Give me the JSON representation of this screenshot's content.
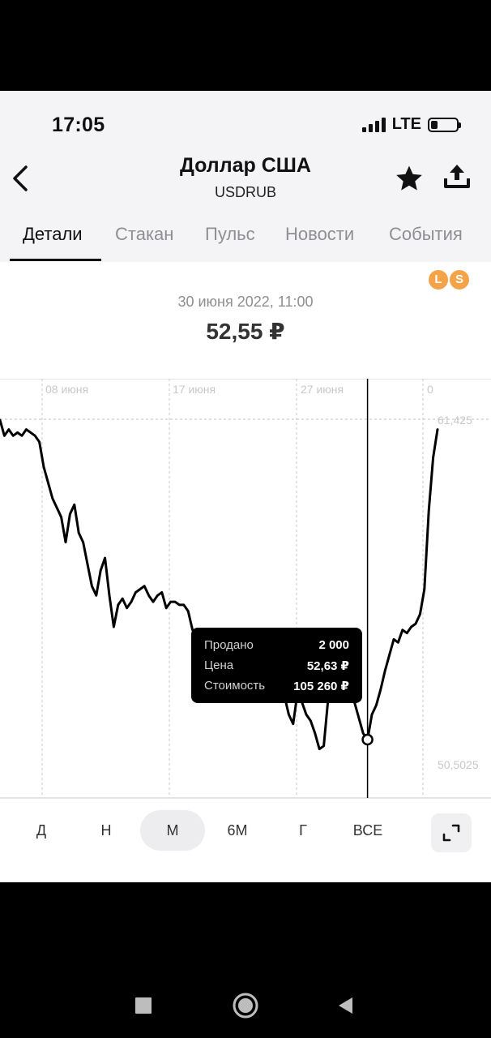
{
  "status_bar": {
    "time": "17:05",
    "network": "LTE"
  },
  "header": {
    "title": "Доллар США",
    "ticker": "USDRUB"
  },
  "icons": {
    "back": "back-chevron-icon",
    "favorite": "star-icon",
    "share": "share-upload-icon",
    "badge": "ls-badge-icon",
    "expand": "expand-icon"
  },
  "tabs": [
    {
      "label": "Детали",
      "active": true
    },
    {
      "label": "Стакан"
    },
    {
      "label": "Пульс"
    },
    {
      "label": "Новости"
    },
    {
      "label": "События"
    }
  ],
  "badge": {
    "left": "L",
    "right": "S"
  },
  "selected_point": {
    "date": "30 июня 2022, 11:00",
    "price": "52,55 ₽"
  },
  "chart": {
    "x_ticks": [
      "08 июня",
      "17 июня",
      "27 июня",
      "0"
    ],
    "y_top_label": "61,425",
    "y_bottom_label": "50,5025"
  },
  "chart_data": {
    "type": "line",
    "title": "",
    "xlabel": "",
    "ylabel": "",
    "ylim": [
      50.5025,
      61.425
    ],
    "x_range": [
      0,
      100
    ],
    "grid": true,
    "series": [
      {
        "values": [
          [
            0,
            61.4
          ],
          [
            1,
            60.9
          ],
          [
            2,
            61.1
          ],
          [
            3,
            60.9
          ],
          [
            4,
            61.0
          ],
          [
            5,
            60.9
          ],
          [
            6,
            61.1
          ],
          [
            7,
            61.0
          ],
          [
            8,
            60.9
          ],
          [
            9,
            60.7
          ],
          [
            10,
            59.9
          ],
          [
            11,
            59.4
          ],
          [
            12,
            58.9
          ],
          [
            13,
            58.6
          ],
          [
            14,
            58.3
          ],
          [
            15,
            57.5
          ],
          [
            16,
            58.4
          ],
          [
            17,
            58.7
          ],
          [
            18,
            57.8
          ],
          [
            19,
            57.5
          ],
          [
            20,
            56.8
          ],
          [
            21,
            56.1
          ],
          [
            22,
            55.8
          ],
          [
            23,
            56.6
          ],
          [
            24,
            57.0
          ],
          [
            25,
            55.8
          ],
          [
            26,
            54.8
          ],
          [
            27,
            55.5
          ],
          [
            28,
            55.7
          ],
          [
            29,
            55.4
          ],
          [
            30,
            55.6
          ],
          [
            31,
            55.9
          ],
          [
            32,
            56.0
          ],
          [
            33,
            56.1
          ],
          [
            34,
            55.8
          ],
          [
            35,
            55.6
          ],
          [
            36,
            55.8
          ],
          [
            37,
            55.9
          ],
          [
            38,
            55.4
          ],
          [
            39,
            55.6
          ],
          [
            40,
            55.6
          ],
          [
            41,
            55.5
          ],
          [
            42,
            55.5
          ],
          [
            43,
            55.3
          ],
          [
            44,
            54.7
          ],
          [
            45,
            54.5
          ],
          [
            46,
            54.4
          ],
          [
            47,
            54.2
          ],
          [
            48,
            53.9
          ],
          [
            49,
            53.8
          ],
          [
            50,
            53.2
          ],
          [
            51,
            53.5
          ],
          [
            52,
            53.2
          ],
          [
            53,
            53.5
          ],
          [
            54,
            53.5
          ],
          [
            55,
            53.2
          ],
          [
            56,
            53.4
          ],
          [
            57,
            52.9
          ],
          [
            58,
            52.5
          ],
          [
            59,
            52.8
          ],
          [
            60,
            53.0
          ],
          [
            61,
            52.8
          ],
          [
            62,
            53.1
          ],
          [
            63,
            52.6
          ],
          [
            64,
            53.0
          ],
          [
            65,
            52.6
          ],
          [
            66,
            52.0
          ],
          [
            67,
            51.7
          ],
          [
            68,
            52.7
          ],
          [
            69,
            52.4
          ],
          [
            70,
            52.0
          ],
          [
            71,
            51.8
          ],
          [
            72,
            51.4
          ],
          [
            73,
            50.9
          ],
          [
            74,
            51.0
          ],
          [
            75,
            52.5
          ],
          [
            76,
            52.7
          ],
          [
            77,
            53.0
          ],
          [
            78,
            52.7
          ],
          [
            79,
            52.8
          ],
          [
            80,
            52.6
          ],
          [
            81,
            52.4
          ],
          [
            82,
            51.9
          ],
          [
            83,
            51.4
          ],
          [
            84,
            51.2
          ],
          [
            85,
            52.0
          ],
          [
            86,
            52.3
          ],
          [
            87,
            52.8
          ],
          [
            88,
            53.4
          ],
          [
            89,
            53.9
          ],
          [
            90,
            54.4
          ],
          [
            91,
            54.3
          ],
          [
            92,
            54.7
          ],
          [
            93,
            54.6
          ],
          [
            94,
            54.8
          ],
          [
            95,
            54.9
          ],
          [
            96,
            55.2
          ],
          [
            97,
            56.0
          ],
          [
            98,
            58.5
          ],
          [
            99,
            60.2
          ],
          [
            100,
            61.1
          ]
        ]
      }
    ],
    "cursor_x": 84,
    "tooltip": {
      "rows": [
        {
          "label": "Продано",
          "value": "2 000"
        },
        {
          "label": "Цена",
          "value": "52,63 ₽"
        },
        {
          "label": "Стоимость",
          "value": "105 260 ₽"
        }
      ]
    }
  },
  "periods": [
    {
      "label": "Д"
    },
    {
      "label": "Н"
    },
    {
      "label": "М",
      "active": true
    },
    {
      "label": "6М"
    },
    {
      "label": "Г"
    },
    {
      "label": "ВСЕ"
    }
  ],
  "nav_bar": {
    "recents": "square-recents-icon",
    "home": "circle-home-icon",
    "back": "triangle-back-icon"
  }
}
